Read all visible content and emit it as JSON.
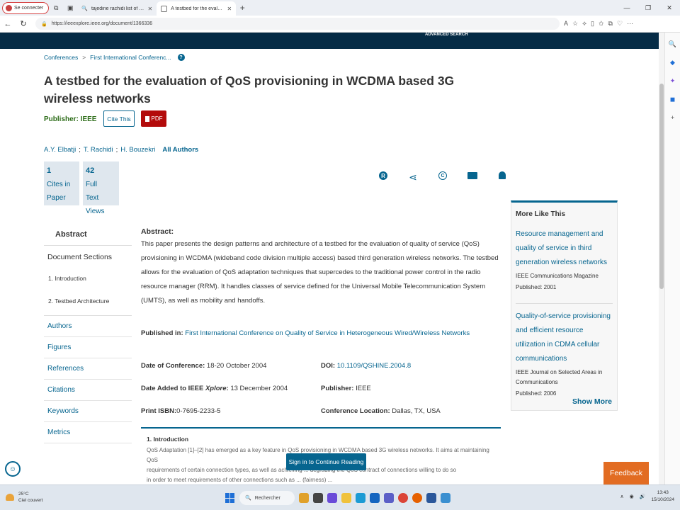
{
  "browser": {
    "profile_label": "Se connecter",
    "tabs": [
      {
        "title": "tajedine rachidi list of publicatio",
        "active": false
      },
      {
        "title": "A testbed for the evaluation of Q",
        "active": true
      }
    ],
    "url": "https://ieeexplore.ieee.org/document/1366336"
  },
  "header": {
    "advanced_search": "ADVANCED SEARCH"
  },
  "breadcrumb": {
    "item1": "Conferences",
    "item2": "First International Conferenc..."
  },
  "document": {
    "title": "A testbed for the evaluation of QoS provisioning in WCDMA based 3G wireless networks",
    "publisher_label": "Publisher:",
    "publisher": "IEEE",
    "cite_label": "Cite This",
    "pdf_label": "PDF",
    "authors": [
      "A.Y. Elbatji",
      "T. Rachidi",
      "H. Bouzekri"
    ],
    "all_authors": "All Authors"
  },
  "metrics": [
    {
      "number": "1",
      "line1": "Cites in",
      "line2": "Paper"
    },
    {
      "number": "42",
      "line1": "Full",
      "line2": "Text Views"
    }
  ],
  "left_nav": {
    "abstract": "Abstract",
    "doc_sections": "Document Sections",
    "sections": [
      "1.  Introduction",
      "2.  Testbed Architecture"
    ],
    "links": [
      "Authors",
      "Figures",
      "References",
      "Citations",
      "Keywords",
      "Metrics"
    ]
  },
  "abstract": {
    "label": "Abstract:",
    "text": "This paper presents the design patterns and architecture of a testbed for the evaluation of quality of service (QoS) provisioning in WCDMA (wideband code division multiple access) based third generation wireless networks. The testbed allows for the evaluation of QoS adaptation techniques that supercedes to the traditional power control in the radio resource manager (RRM). It handles classes of service defined for the Universal Mobile Telecommunication System (UMTS), as well as mobility and handoffs."
  },
  "published_in": {
    "label": "Published in:",
    "value": "First International Conference on Quality of Service in Heterogeneous Wired/Wireless Networks"
  },
  "meta": {
    "date_conf_label": "Date of Conference:",
    "date_conf": "18-20 October 2004",
    "date_added_label_a": "Date Added to IEEE ",
    "date_added_label_b": "Xplore",
    "date_added_label_c": ":",
    "date_added": "13 December 2004",
    "isbn_label": "Print ISBN:",
    "isbn": "0-7695-2233-5",
    "doi_label": "DOI:",
    "doi": "10.1109/QSHINE.2004.8",
    "publisher_label": "Publisher:",
    "publisher": "IEEE",
    "location_label": "Conference Location:",
    "location": "Dallas, TX, USA"
  },
  "intro": {
    "heading": "1. Introduction",
    "line1": "QoS Adaptation [1]–[2] has emerged as a key feature in QoS provisioning in WCDMA based 3G wireless networks. It aims at maintaining QoS",
    "line2": "requirements of certain connection types, as well as achieving ... degrading the QoS contract of connections willing to do so",
    "line3": "in order to meet requirements of other connections such as ... (fairness) ...",
    "signin": "Sign in to Continue Reading"
  },
  "more_like_this": {
    "title": "More Like This",
    "items": [
      {
        "title": "Resource management and quality of service in third generation wireless networks",
        "source": "IEEE Communications Magazine",
        "published": "Published: 2001"
      },
      {
        "title": "Quality-of-service provisioning and efficient resource utilization in CDMA cellular communications",
        "source": "IEEE Journal on Selected Areas in Communications",
        "published": "Published: 2006"
      }
    ],
    "show_more": "Show More"
  },
  "feedback": "Feedback",
  "taskbar": {
    "temp": "25°C",
    "weather": "Ciel couvert",
    "search": "Rechercher",
    "time": "13:43",
    "date": "15/10/2024"
  },
  "colors": {
    "ieee_blue": "#06658f",
    "navy": "#062c46",
    "pdf_red": "#b30b0b",
    "feedback_orange": "#e26c22"
  }
}
